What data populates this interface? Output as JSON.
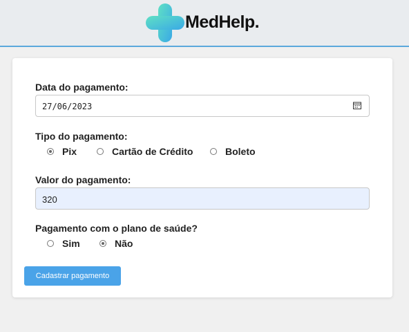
{
  "header": {
    "logo_text": "MedHelp.",
    "brand_colors": {
      "cross_light": "#5fe0c4",
      "cross_dark": "#3aa9e6",
      "divider": "#5aa9dc"
    }
  },
  "form": {
    "date_label": "Data do pagamento:",
    "date_value": "27/06/2023",
    "type_label": "Tipo do pagamento:",
    "type_options": [
      {
        "label": "Pix",
        "selected": true
      },
      {
        "label": "Cartão de Crédito",
        "selected": false
      },
      {
        "label": "Boleto",
        "selected": false
      }
    ],
    "value_label": "Valor do pagamento:",
    "value_value": "320",
    "plan_label": "Pagamento com o plano de saúde?",
    "plan_options": [
      {
        "label": "Sim",
        "selected": false
      },
      {
        "label": "Não",
        "selected": true
      }
    ],
    "submit_label": "Cadastrar pagamento",
    "submit_color": "#4aa3e8"
  },
  "icons": {
    "logo": "medical-cross-icon",
    "date_picker": "calendar-icon"
  }
}
